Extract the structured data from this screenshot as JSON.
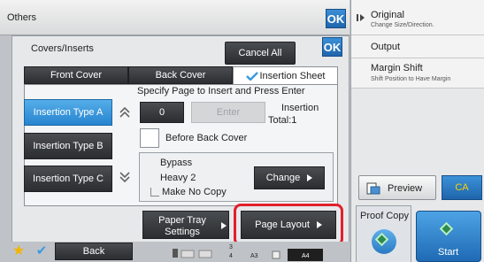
{
  "header": {
    "title": "Others",
    "ok_label": "OK"
  },
  "right_panel": {
    "items": [
      {
        "label": "Original",
        "sub": "Change Size/Direction."
      },
      {
        "label": "Output",
        "sub": ""
      },
      {
        "label": "Margin Shift",
        "sub": "Shift Position to Have Margin"
      }
    ],
    "preview_label": "Preview",
    "ca_label": "CA",
    "proof_copy_label": "Proof Copy",
    "start_label": "Start"
  },
  "dialog": {
    "title": "Covers/Inserts",
    "ok_label": "OK",
    "cancel_all_label": "Cancel All",
    "tabs": [
      {
        "label": "Front Cover",
        "active": false
      },
      {
        "label": "Back Cover",
        "active": false
      },
      {
        "label": "Insertion Sheet",
        "active": true
      }
    ],
    "instruction": "Specify Page to Insert and Press Enter",
    "insertion_types": [
      {
        "label": "Insertion Type A",
        "selected": true
      },
      {
        "label": "Insertion Type B",
        "selected": false
      },
      {
        "label": "Insertion Type C",
        "selected": false
      }
    ],
    "page_value": "0",
    "enter_label": "Enter",
    "insertion_label": "Insertion",
    "total_label": "Total:1",
    "before_back_cover_label": "Before Back Cover",
    "paper": {
      "tray": "Bypass",
      "type": "Heavy 2",
      "make_no_copy": "Make No Copy"
    },
    "change_label": "Change",
    "paper_tray_settings": {
      "line1": "Paper Tray",
      "line2": "Settings"
    },
    "page_layout_label": "Page Layout"
  },
  "bottom": {
    "back_label": "Back",
    "status": {
      "n3": "3",
      "n4": "4",
      "size1": "A3",
      "size2": "A4"
    }
  },
  "colors": {
    "accent_blue": "#2784cf",
    "highlight_red": "#e1202c",
    "ca_text": "#ffd100"
  }
}
